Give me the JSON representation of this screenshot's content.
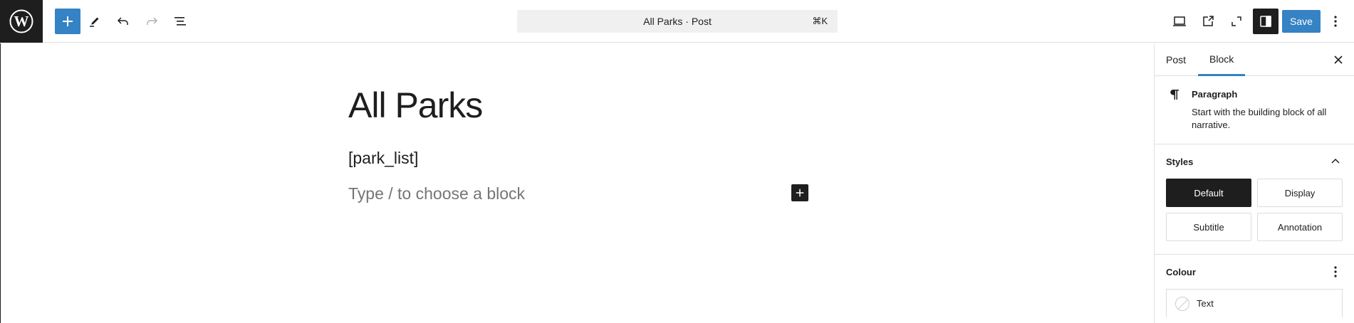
{
  "toolbar": {
    "add_block_icon": "plus-icon",
    "tools_icon": "pencil-icon",
    "undo_icon": "undo-icon",
    "redo_icon": "redo-icon",
    "list_view_icon": "list-view-icon",
    "command_bar_text": "All Parks · Post",
    "command_shortcut": "⌘K",
    "preview_icon": "desktop-icon",
    "view_post_icon": "external-link-icon",
    "fullscreen_icon": "fullscreen-icon",
    "settings_icon": "sidebar-toggle-icon",
    "save_label": "Save",
    "options_icon": "more-vertical-icon"
  },
  "editor": {
    "title": "All Parks",
    "shortcode_paragraph": "[park_list]",
    "placeholder": "Type / to choose a block"
  },
  "sidebar": {
    "tabs": [
      {
        "label": "Post",
        "active": false
      },
      {
        "label": "Block",
        "active": true
      }
    ],
    "block": {
      "name": "Paragraph",
      "description": "Start with the building block of all narrative."
    },
    "styles": {
      "heading": "Styles",
      "options": [
        "Default",
        "Display",
        "Subtitle",
        "Annotation"
      ],
      "selected": "Default"
    },
    "colour": {
      "heading": "Colour",
      "items": [
        "Text"
      ]
    }
  },
  "colors": {
    "accent": "#3582c4",
    "dark": "#1e1e1e",
    "border": "#e0e0e0",
    "placeholder": "#757575"
  }
}
